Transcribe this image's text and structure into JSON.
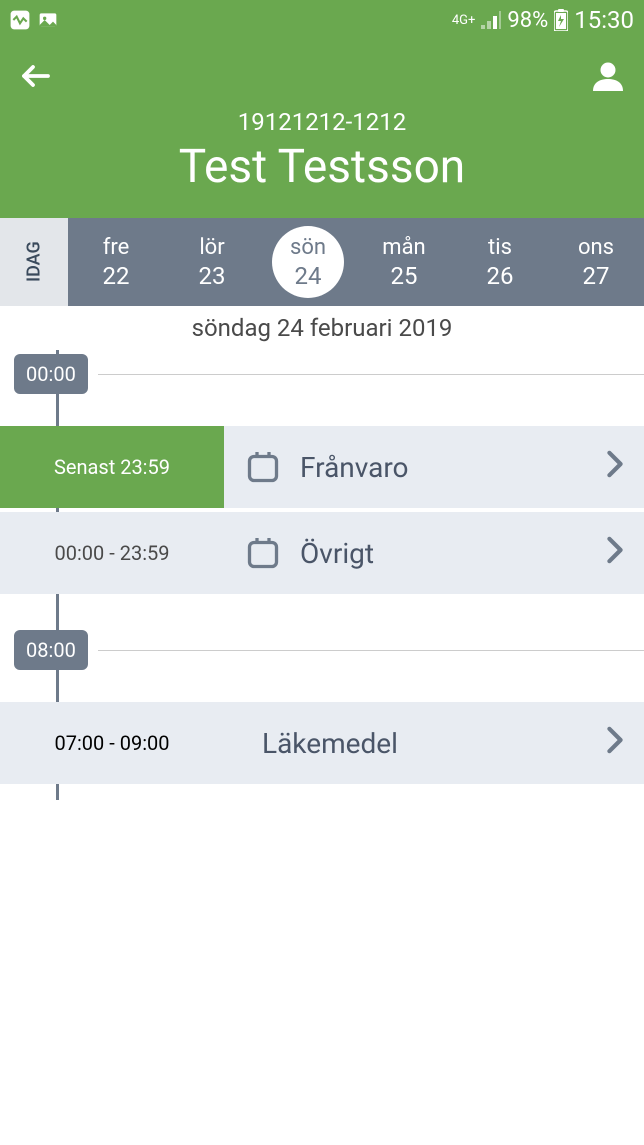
{
  "status_bar": {
    "network": "4G+",
    "battery": "98%",
    "time": "15:30"
  },
  "header": {
    "person_id": "19121212-1212",
    "person_name": "Test Testsson"
  },
  "day_selector": {
    "today_label": "IDAG",
    "days": [
      {
        "name": "fre",
        "num": "22"
      },
      {
        "name": "lör",
        "num": "23"
      },
      {
        "name": "sön",
        "num": "24"
      },
      {
        "name": "mån",
        "num": "25"
      },
      {
        "name": "tis",
        "num": "26"
      },
      {
        "name": "ons",
        "num": "27"
      }
    ],
    "selected_index": 2
  },
  "date_header": "söndag 24 februari 2019",
  "timeline": {
    "markers": [
      {
        "time": "00:00"
      },
      {
        "time": "08:00"
      }
    ],
    "events": [
      {
        "time_label": "Senast 23:59",
        "title": "Frånvaro",
        "has_icon": true,
        "style": "green"
      },
      {
        "time_label": "00:00 - 23:59",
        "title": "Övrigt",
        "has_icon": true,
        "style": "gray"
      },
      {
        "time_label": "07:00 - 09:00",
        "title": "Läkemedel",
        "has_icon": false,
        "style": "gray"
      }
    ]
  }
}
